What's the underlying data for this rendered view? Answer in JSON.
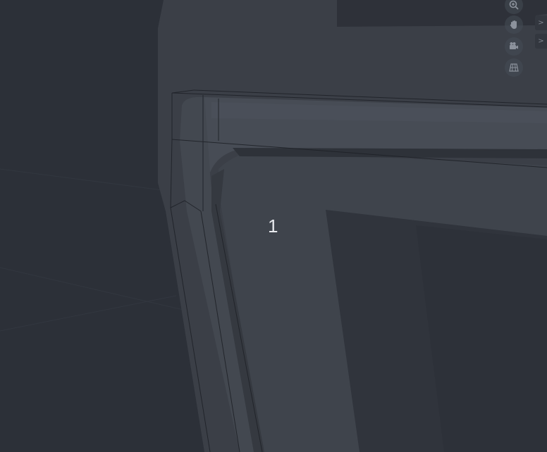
{
  "viewport": {
    "element_index_label": "1"
  },
  "navigation_gizmo": {
    "zoom_icon": "zoom-in-icon",
    "pan_icon": "hand-pan-icon",
    "camera_icon": "camera-icon",
    "ortho_icon": "perspective-grid-icon"
  },
  "sidebar_tabs": [
    {
      "label": ">"
    },
    {
      "label": ">"
    }
  ],
  "colors": {
    "background": "#2c3038",
    "object_face_light": "#3e434b",
    "object_face_dark": "#30343c",
    "wireframe": "#1f2228",
    "label_text": "#e8eaee"
  }
}
